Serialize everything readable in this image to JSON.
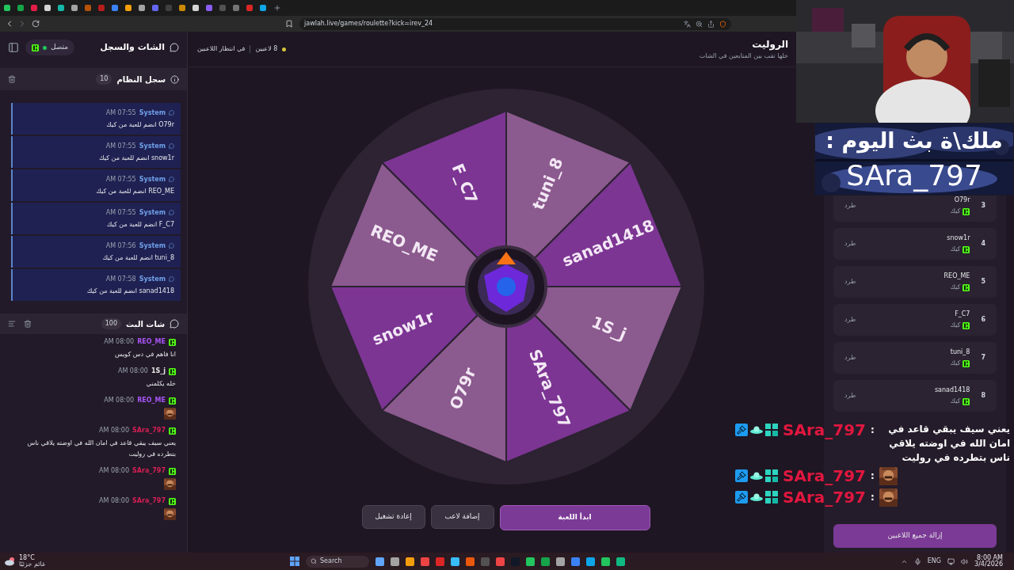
{
  "browser": {
    "url": "jawlah.live/games/roulette?kick=irev_24"
  },
  "chat_panel": {
    "title": "الشات والسجل",
    "status": "متصل",
    "connected": true,
    "system_log": {
      "title": "سجل النظام",
      "count": "10",
      "messages": [
        {
          "sender": "System",
          "time": "AM 07:55",
          "text": "O79r انضم للعبة من كيك"
        },
        {
          "sender": "System",
          "time": "AM 07:55",
          "text": "snow1r انضم للعبة من كيك"
        },
        {
          "sender": "System",
          "time": "AM 07:55",
          "text": "REO_ME انضم للعبة من كيك"
        },
        {
          "sender": "System",
          "time": "AM 07:55",
          "text": "F_C7 انضم للعبة من كيك"
        },
        {
          "sender": "System",
          "time": "AM 07:56",
          "text": "tuni_8 انضم للعبة من كيك"
        },
        {
          "sender": "System",
          "time": "AM 07:58",
          "text": "sanad1418 انضم للعبة من كيك"
        }
      ]
    },
    "stream_chat": {
      "title": "شات البث",
      "count": "100",
      "messages": [
        {
          "kind": "text",
          "user": "REO_ME",
          "color": "#a855f7",
          "time": "AM 08:00",
          "text": "انا فاهم في دس كويس"
        },
        {
          "kind": "text",
          "user": "1S_j",
          "color": "#e5e5e5",
          "time": "AM 08:00",
          "text": "خله يكلمني"
        },
        {
          "kind": "emote",
          "user": "REO_ME",
          "color": "#a855f7",
          "time": "AM 08:00"
        },
        {
          "kind": "text",
          "user": "SAra_797",
          "color": "#d61f55",
          "time": "AM 08:00",
          "text": "يعني سيف يبقي قاعد في امان الله في اوضته يلاقي ناس بتطرده في روليت"
        },
        {
          "kind": "emote",
          "user": "SAra_797",
          "color": "#d61f55",
          "time": "AM 08:00"
        },
        {
          "kind": "emote",
          "user": "SAra_797",
          "color": "#d61f55",
          "time": "AM 08:00"
        }
      ]
    }
  },
  "game": {
    "title": "الروليت",
    "subtitle": "خلها تقب بين المتابعين في الشات",
    "player_count": "8 لاعبين",
    "status": "في انتظار اللاعبين",
    "slices": [
      {
        "label": "tuni_8",
        "color": "#8b5a8e"
      },
      {
        "label": "sanad1418",
        "color": "#7c3593"
      },
      {
        "label": "1S_j",
        "color": "#8b5a8e"
      },
      {
        "label": "SAra_797",
        "color": "#7c3593"
      },
      {
        "label": "O79r",
        "color": "#8b5a8e"
      },
      {
        "label": "snow1r",
        "color": "#7c3593"
      },
      {
        "label": "REO_ME",
        "color": "#8b5a8e"
      },
      {
        "label": "F_C7",
        "color": "#7c3593"
      }
    ],
    "buttons": [
      {
        "kind": "primary",
        "label": "ابدأ اللعبة"
      },
      {
        "kind": "secondary",
        "label": "إضافة لاعب"
      },
      {
        "kind": "secondary",
        "label": "إعادة تشغيل"
      }
    ]
  },
  "players": {
    "rows": [
      {
        "rank": "3",
        "name": "O79r",
        "platform": "كيك",
        "action": "طرد"
      },
      {
        "rank": "4",
        "name": "snow1r",
        "platform": "كيك",
        "action": "طرد"
      },
      {
        "rank": "5",
        "name": "REO_ME",
        "platform": "كيك",
        "action": "طرد"
      },
      {
        "rank": "6",
        "name": "F_C7",
        "platform": "كيك",
        "action": "طرد"
      },
      {
        "rank": "7",
        "name": "tuni_8",
        "platform": "كيك",
        "action": "طرد"
      },
      {
        "rank": "8",
        "name": "sanad1418",
        "platform": "كيك",
        "action": "طرد"
      }
    ],
    "clear_button": "إزالة جميع اللاعبين"
  },
  "stream_overlay": {
    "banner": {
      "line_1": "ملك\\ة بث اليوم :",
      "line_2": "SAra_797"
    },
    "chat": [
      {
        "kind": "text",
        "user": "SAra_797",
        "separator": ":",
        "text": "يعني سيف يبقي قاعد في امان الله في اوضته يلاقي ناس بتطرده في روليت"
      },
      {
        "kind": "emote",
        "user": "SAra_797",
        "separator": ":"
      },
      {
        "kind": "emote",
        "user": "SAra_797",
        "separator": ":"
      }
    ]
  },
  "taskbar": {
    "weather": {
      "temp": "18°C",
      "condition": "غائم جزئيًا"
    },
    "search": {
      "placeholder": "Search"
    },
    "language": "ENG",
    "time": "8:00 AM",
    "date": "3/4/2026"
  }
}
